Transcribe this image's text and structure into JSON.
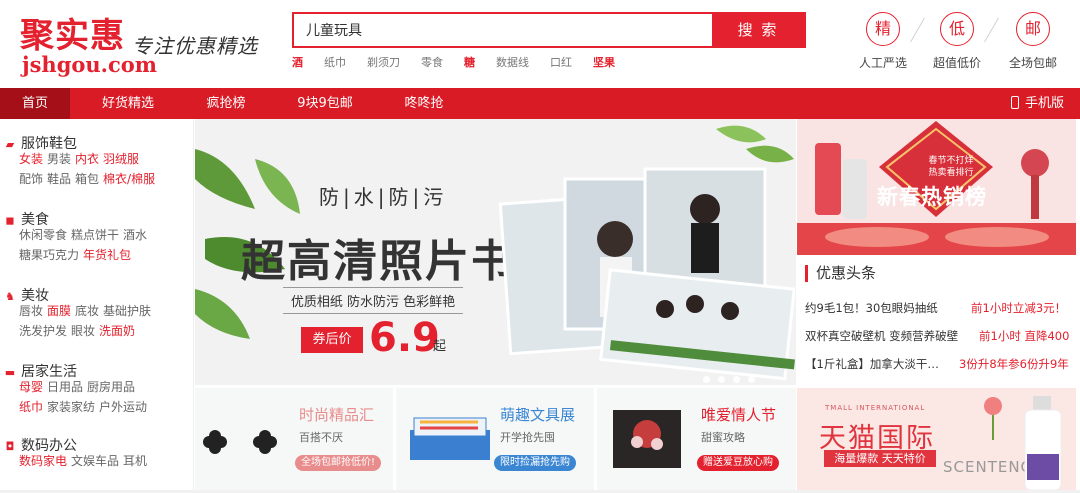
{
  "logo": {
    "name": "聚实惠",
    "slogan": "专注优惠精选",
    "domain": "jshgou.com"
  },
  "search": {
    "value": "儿童玩具",
    "button_label": "搜 索",
    "hotwords": [
      {
        "text": "酒",
        "hot": true
      },
      {
        "text": "纸巾",
        "hot": false
      },
      {
        "text": "剃须刀",
        "hot": false
      },
      {
        "text": "零食",
        "hot": false
      },
      {
        "text": "糖",
        "hot": true
      },
      {
        "text": "数据线",
        "hot": false
      },
      {
        "text": "口红",
        "hot": false
      },
      {
        "text": "坚果",
        "hot": true
      }
    ]
  },
  "features": [
    {
      "icon_char": "精",
      "label": "人工严选"
    },
    {
      "icon_char": "低",
      "label": "超值低价"
    },
    {
      "icon_char": "邮",
      "label": "全场包邮"
    }
  ],
  "nav": {
    "items": [
      "首页",
      "好货精选",
      "疯抢榜",
      "9块9包邮",
      "咚咚抢"
    ],
    "mobile_label": "手机版"
  },
  "categories": [
    {
      "title": "服饰鞋包",
      "icon": "shirt-icon",
      "icon_char": "▰",
      "lines": [
        [
          {
            "t": "女装",
            "r": true
          },
          {
            "t": "男装",
            "r": false
          },
          {
            "t": "内衣",
            "r": true
          },
          {
            "t": "羽绒服",
            "r": true
          }
        ],
        [
          {
            "t": "配饰",
            "r": false
          },
          {
            "t": "鞋品",
            "r": false
          },
          {
            "t": "箱包",
            "r": false
          },
          {
            "t": "棉衣/棉服",
            "r": true
          }
        ]
      ]
    },
    {
      "title": "美食",
      "icon": "food-icon",
      "icon_char": "◼",
      "lines": [
        [
          {
            "t": "休闲零食",
            "r": false
          },
          {
            "t": "糕点饼干",
            "r": false
          },
          {
            "t": "酒水",
            "r": false
          }
        ],
        [
          {
            "t": "糖果巧克力",
            "r": false
          },
          {
            "t": "年货礼包",
            "r": true
          }
        ]
      ]
    },
    {
      "title": "美妆",
      "icon": "cosmetics-icon",
      "icon_char": "♞",
      "lines": [
        [
          {
            "t": "唇妆",
            "r": false
          },
          {
            "t": "面膜",
            "r": true
          },
          {
            "t": "底妆",
            "r": false
          },
          {
            "t": "基础护肤",
            "r": false
          }
        ],
        [
          {
            "t": "洗发护发",
            "r": false
          },
          {
            "t": "眼妆",
            "r": false
          },
          {
            "t": "洗面奶",
            "r": true
          }
        ]
      ]
    },
    {
      "title": "居家生活",
      "icon": "home-icon",
      "icon_char": "▬",
      "lines": [
        [
          {
            "t": "母婴",
            "r": true
          },
          {
            "t": "日用品",
            "r": false
          },
          {
            "t": "厨房用品",
            "r": false
          }
        ],
        [
          {
            "t": "纸巾",
            "r": true
          },
          {
            "t": "家装家纺",
            "r": false
          },
          {
            "t": "户外运动",
            "r": false
          }
        ]
      ]
    },
    {
      "title": "数码办公",
      "icon": "camera-icon",
      "icon_char": "◘",
      "lines": [
        [
          {
            "t": "数码家电",
            "r": true
          },
          {
            "t": "文娱车品",
            "r": false
          },
          {
            "t": "耳机",
            "r": false
          }
        ]
      ]
    }
  ],
  "banner": {
    "subtitle": "防|水|防|污",
    "title": "超高清照片书",
    "tagline": "优质相纸 防水防污 色彩鲜艳",
    "price_label": "券后价",
    "price": "6.9",
    "price_suffix": "起",
    "dot_count": 4
  },
  "promo": {
    "badge_line1": "春节不打烊",
    "badge_line2": "热卖看排行",
    "title": "新春热销榜"
  },
  "news": {
    "title": "优惠头条",
    "items": [
      {
        "text": "约9毛1包！30包眼妈抽纸",
        "deal": "前1小时立减3元！"
      },
      {
        "text": "双杯真空破壁机 变频营养破壁",
        "deal": "前1小时 直降400"
      },
      {
        "text": "【1斤礼盒】加拿大淡干…",
        "deal": "3份升8年参6份升9年"
      }
    ]
  },
  "tmall": {
    "small": "TMALL INTERNATIONAL",
    "title": "天猫国际",
    "bar": "海量爆款 天天特价",
    "scent": "SCENTENCE"
  },
  "cards": [
    {
      "title": "时尚精品汇",
      "sub": "百搭不厌",
      "btn": "全场包邮抢低价!",
      "color": "#e98c8c"
    },
    {
      "title": "萌趣文具展",
      "sub": "开学抢先囤",
      "btn": "限时捡漏抢先购",
      "color": "#3b86d3"
    },
    {
      "title": "唯爱情人节",
      "sub": "甜蜜攻略",
      "btn": "赠送爱豆放心购",
      "color": "#e4212e"
    }
  ],
  "colors": {
    "brand": "#e4212e",
    "nav": "#d91b26",
    "nav_active": "#a50f17"
  }
}
